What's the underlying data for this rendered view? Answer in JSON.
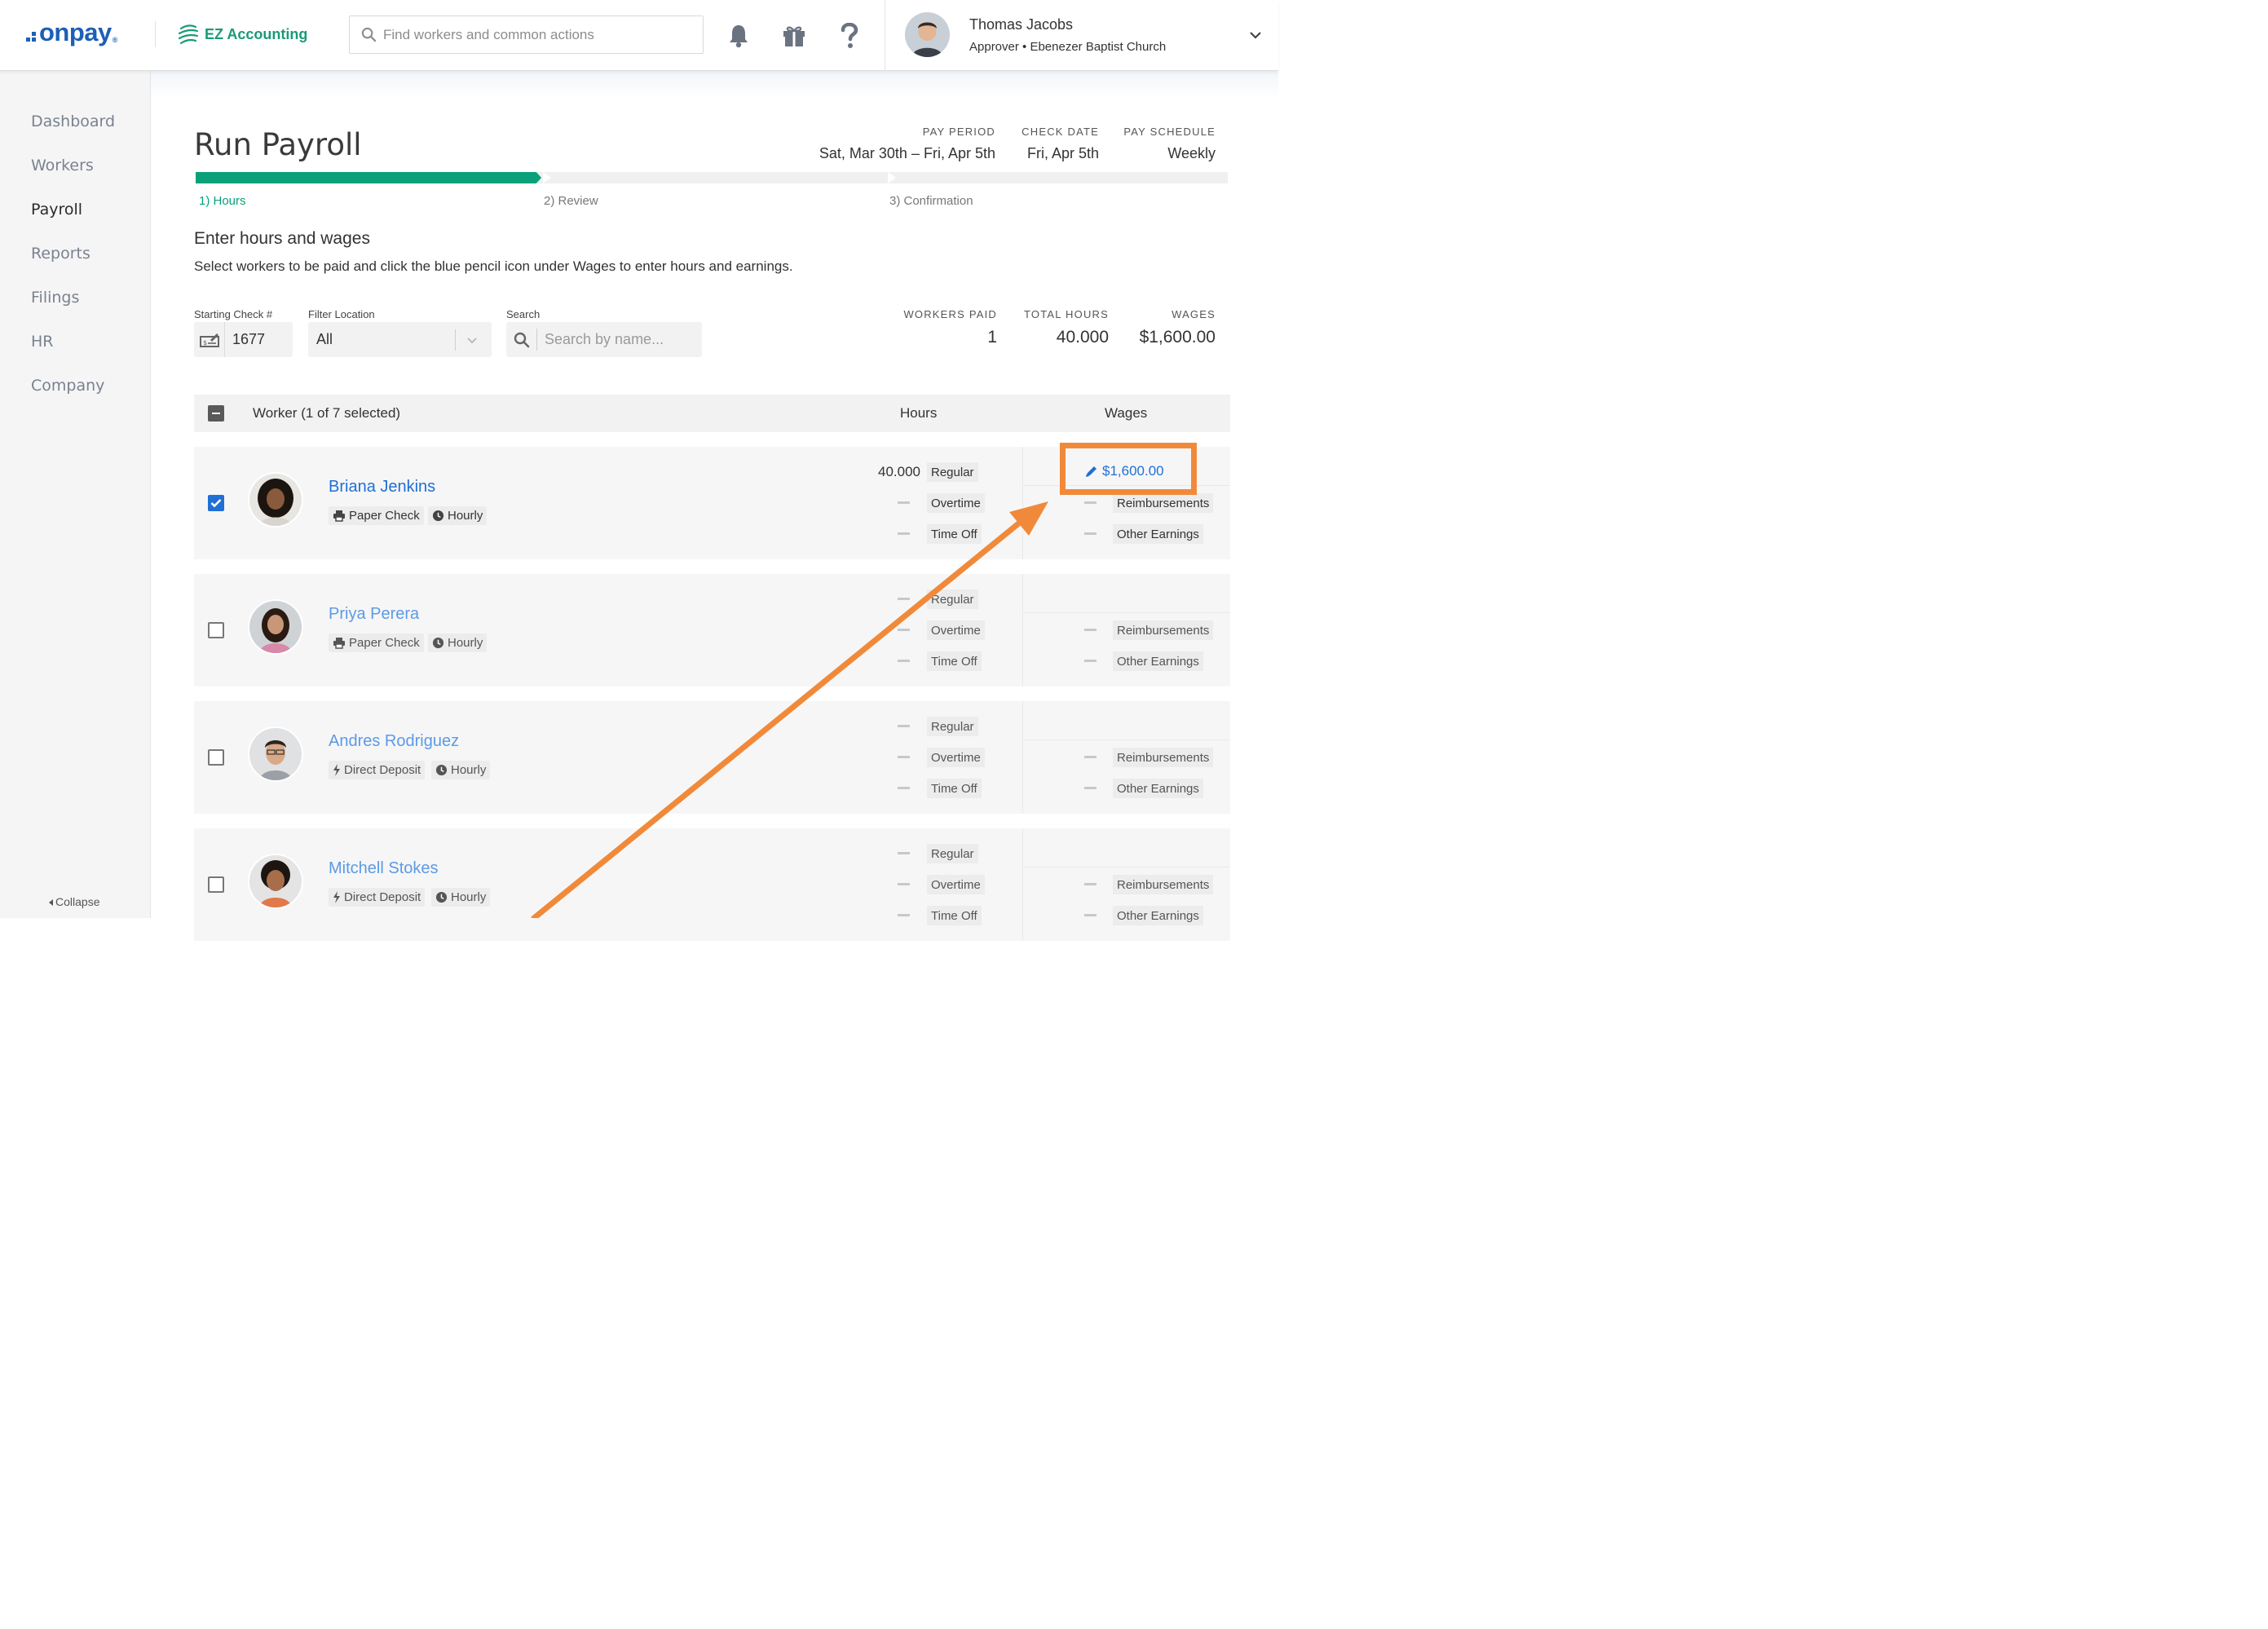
{
  "header": {
    "logo_text": "onpay",
    "logo_reg": "®",
    "partner_name": "EZ Accounting",
    "search_placeholder": "Find workers and common actions",
    "user_name": "Thomas Jacobs",
    "user_role": "Approver • Ebenezer Baptist Church",
    "icons": [
      "search-icon",
      "bell-icon",
      "gift-icon",
      "help-icon",
      "chevron-down-icon"
    ]
  },
  "sidebar": {
    "items": [
      {
        "label": "Dashboard",
        "active": false
      },
      {
        "label": "Workers",
        "active": false
      },
      {
        "label": "Payroll",
        "active": true
      },
      {
        "label": "Reports",
        "active": false
      },
      {
        "label": "Filings",
        "active": false
      },
      {
        "label": "HR",
        "active": false
      },
      {
        "label": "Company",
        "active": false
      }
    ],
    "collapse_label": "Collapse"
  },
  "page": {
    "title": "Run Payroll",
    "meta": {
      "pay_period_label": "PAY PERIOD",
      "pay_period_value": "Sat, Mar 30th – Fri, Apr 5th",
      "check_date_label": "CHECK DATE",
      "check_date_value": "Fri, Apr 5th",
      "pay_schedule_label": "PAY SCHEDULE",
      "pay_schedule_value": "Weekly"
    },
    "steps": [
      "1) Hours",
      "2) Review",
      "3) Confirmation"
    ],
    "progress_fraction": 0.335,
    "section_title": "Enter hours and wages",
    "section_desc": "Select workers to be paid and click the blue pencil icon under Wages to enter hours and earnings."
  },
  "filters": {
    "starting_check_label": "Starting Check #",
    "starting_check_value": "1677",
    "filter_location_label": "Filter Location",
    "filter_location_value": "All",
    "search_label": "Search",
    "search_placeholder": "Search by name..."
  },
  "stats": {
    "workers_paid_label": "WORKERS PAID",
    "workers_paid_value": "1",
    "total_hours_label": "TOTAL HOURS",
    "total_hours_value": "40.000",
    "wages_label": "WAGES",
    "wages_value": "$1,600.00"
  },
  "table": {
    "worker_header": "Worker (1 of 7 selected)",
    "hours_header": "Hours",
    "wages_header": "Wages",
    "pay_labels": {
      "regular": "Regular",
      "overtime": "Overtime",
      "time_off": "Time Off",
      "reimbursements": "Reimbursements",
      "other_earnings": "Other Earnings"
    },
    "rows": [
      {
        "name": "Briana Jenkins",
        "pay_method": "Paper Check",
        "pay_type": "Hourly",
        "checked": true,
        "regular_hours": "40.000",
        "wage": "$1,600.00"
      },
      {
        "name": "Priya Perera",
        "pay_method": "Paper Check",
        "pay_type": "Hourly",
        "checked": false
      },
      {
        "name": "Andres Rodriguez",
        "pay_method": "Direct Deposit",
        "pay_type": "Hourly",
        "checked": false
      },
      {
        "name": "Mitchell Stokes",
        "pay_method": "Direct Deposit",
        "pay_type": "Hourly",
        "checked": false
      }
    ]
  },
  "colors": {
    "brand_blue": "#1d5fb8",
    "link_blue": "#1f6fd6",
    "progress_green": "#0aa17a",
    "annotation_orange": "#f08a3a"
  }
}
